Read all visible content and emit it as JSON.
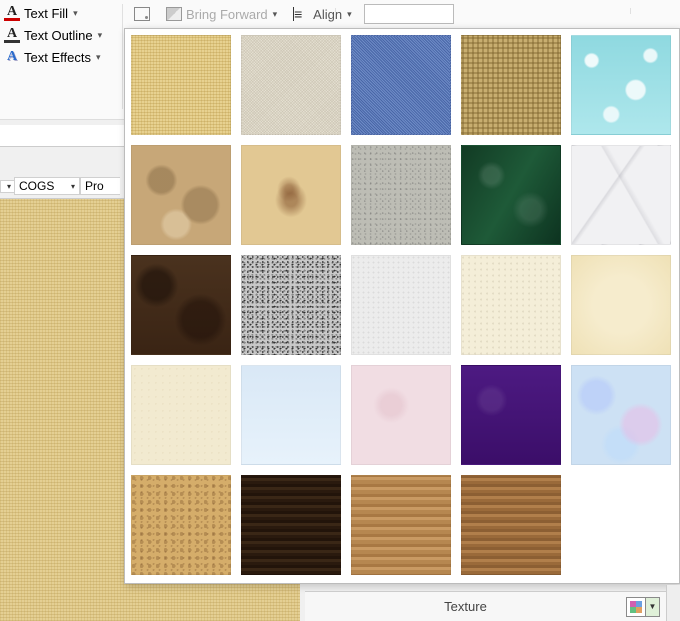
{
  "ribbon": {
    "text_fill": "Text Fill",
    "text_outline": "Text Outline",
    "text_effects": "Text Effects",
    "bring_forward": "Bring Forward",
    "align": "Align"
  },
  "columns": {
    "cogs": "COGS",
    "pro_fragment": "Pro"
  },
  "texture_panel": {
    "bottom_label": "Texture",
    "swatches": [
      {
        "name": "papyrus",
        "cls": "tx-papyrus"
      },
      {
        "name": "canvas",
        "cls": "tx-canvas"
      },
      {
        "name": "denim",
        "cls": "tx-denim"
      },
      {
        "name": "woven-mat",
        "cls": "tx-wovenmat"
      },
      {
        "name": "water-droplets",
        "cls": "tx-water"
      },
      {
        "name": "paper-bag",
        "cls": "tx-paperbag"
      },
      {
        "name": "fish-fossil",
        "cls": "tx-fossil"
      },
      {
        "name": "sand",
        "cls": "tx-sand"
      },
      {
        "name": "green-marble",
        "cls": "tx-greenmarble"
      },
      {
        "name": "white-marble",
        "cls": "tx-whitemarble"
      },
      {
        "name": "brown-marble",
        "cls": "tx-brownmarble"
      },
      {
        "name": "granite",
        "cls": "tx-granite"
      },
      {
        "name": "newsprint",
        "cls": "tx-newsprint"
      },
      {
        "name": "recycled-paper",
        "cls": "tx-recycled"
      },
      {
        "name": "parchment",
        "cls": "tx-parchment"
      },
      {
        "name": "stationery",
        "cls": "tx-stationery"
      },
      {
        "name": "blue-tissue",
        "cls": "tx-bluetissue"
      },
      {
        "name": "pink-tissue",
        "cls": "tx-pinktissue"
      },
      {
        "name": "purple-mesh",
        "cls": "tx-purplemesh"
      },
      {
        "name": "bouquet",
        "cls": "tx-bouquet"
      },
      {
        "name": "cork",
        "cls": "tx-cork"
      },
      {
        "name": "walnut",
        "cls": "tx-walnut"
      },
      {
        "name": "oak",
        "cls": "tx-oak"
      },
      {
        "name": "medium-wood",
        "cls": "tx-mediumwood"
      }
    ]
  }
}
